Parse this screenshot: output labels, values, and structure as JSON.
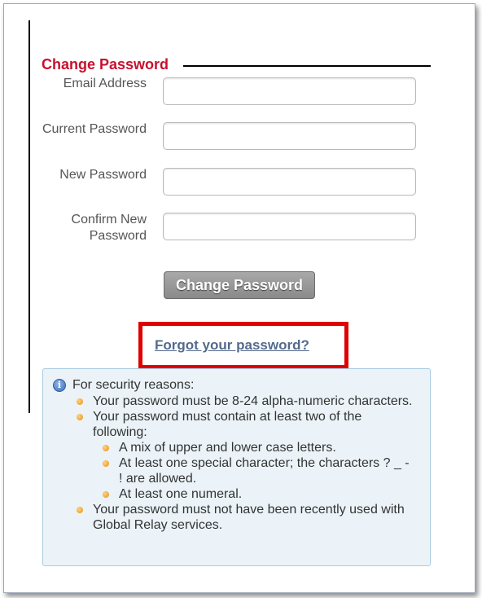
{
  "form": {
    "title": "Change Password",
    "fields": [
      {
        "label": "Email Address",
        "value": ""
      },
      {
        "label": "Current Password",
        "value": ""
      },
      {
        "label": "New Password",
        "value": ""
      },
      {
        "label": "Confirm New Password",
        "value": ""
      }
    ],
    "submit_label": "Change Password",
    "forgot_link": "Forgot your password?"
  },
  "info": {
    "icon": "info-icon",
    "heading": "For security reasons:",
    "rules": [
      "Your password must be 8-24 alpha-numeric characters.",
      "Your password must contain at least two of the following:",
      "Your password must not have been recently used with Global Relay services."
    ],
    "sub_rules": [
      "A mix of upper and lower case letters.",
      "At least one special character; the characters ? _ - ! are allowed.",
      "At least one numeral."
    ]
  },
  "colors": {
    "title": "#c8102e",
    "highlight": "#e00000",
    "link": "#546a8c",
    "info_bg": "#ebf3f8",
    "bullet": "#e8901a"
  }
}
